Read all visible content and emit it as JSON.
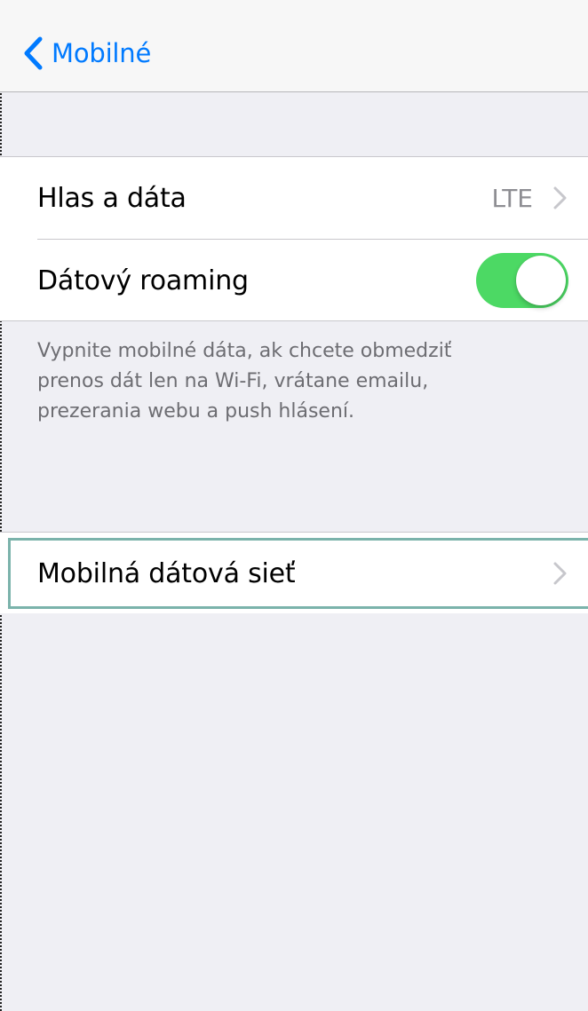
{
  "navbar": {
    "back_label": "Mobilné",
    "back_icon": "chevron-left-icon"
  },
  "section1": {
    "rows": [
      {
        "label": "Hlas a dáta",
        "value": "LTE",
        "accessory": "chevron-right-icon"
      },
      {
        "label": "Dátový roaming",
        "toggle_on": true
      }
    ],
    "footer": "Vypnite mobilné dáta, ak chcete obmedziť prenos dát len na Wi-Fi, vrátane emailu, prezerania webu a push hlásení."
  },
  "section2": {
    "rows": [
      {
        "label": "Mobilná dátová sieť",
        "accessory": "chevron-right-icon"
      }
    ]
  },
  "colors": {
    "accent": "#007aff",
    "toggle_on": "#4cd964",
    "background": "#efeff4",
    "secondary_text": "#8e8e93",
    "focus_ring": "#7bb3ab"
  }
}
